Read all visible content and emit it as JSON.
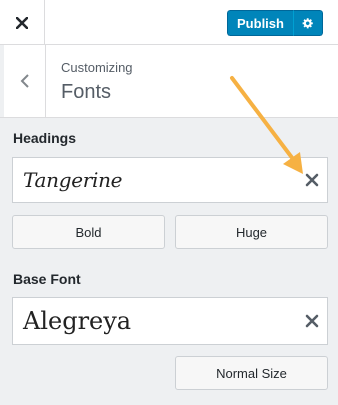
{
  "topbar": {
    "close_icon": "close-icon",
    "publish_label": "Publish",
    "settings_icon": "gear-icon"
  },
  "section": {
    "back_icon": "chevron-left-icon",
    "breadcrumb": "Customizing",
    "title": "Fonts"
  },
  "headings": {
    "label": "Headings",
    "font": "Tangerine",
    "clear_icon": "close-icon",
    "weight_button": "Bold",
    "size_button": "Huge"
  },
  "base_font": {
    "label": "Base Font",
    "font": "Alegreya",
    "clear_icon": "close-icon",
    "size_button": "Normal Size"
  },
  "colors": {
    "accent": "#0085ba",
    "arrow": "#f6b143",
    "panel_bg": "#eef0f2"
  }
}
